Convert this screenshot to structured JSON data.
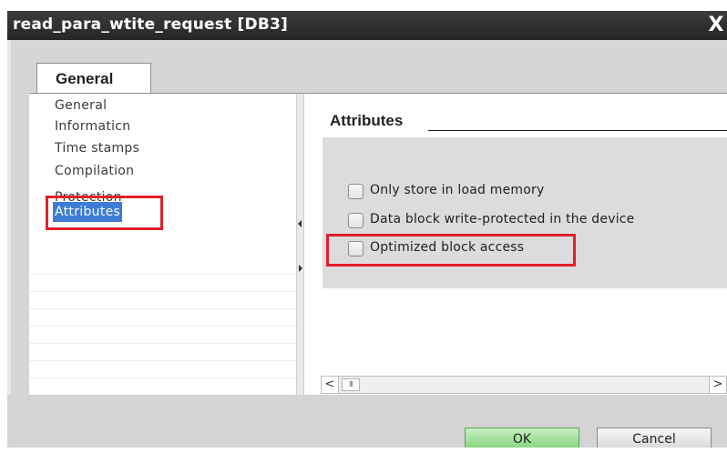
{
  "window": {
    "title": "read_para_wtite_request [DB3]",
    "close_glyph": "X"
  },
  "tabs": [
    {
      "label": "General",
      "selected": true
    }
  ],
  "nav": {
    "items": [
      {
        "label": "General"
      },
      {
        "label": "Informaticn"
      },
      {
        "label": "Time stamps"
      },
      {
        "label": "Compilation"
      },
      {
        "label": "Protection"
      },
      {
        "label": "Attributes",
        "selected": true
      }
    ]
  },
  "attributes": {
    "section_title": "Attributes",
    "options": [
      {
        "label": "Only store in load memory",
        "checked": false
      },
      {
        "label": "Data block write-protected in the device",
        "checked": false
      },
      {
        "label": "Optimized block access",
        "checked": false
      }
    ]
  },
  "scrollbar": {
    "left_glyph": "<",
    "thumb_glyph": "III",
    "right_glyph": ">"
  },
  "buttons": {
    "ok": "OK",
    "cancel": "Cancel"
  },
  "colors": {
    "highlight_box": "#e0202a",
    "selection": "#3e7bd6",
    "ok_button": "#82d27a",
    "titlebar": "#2e2e2e"
  }
}
